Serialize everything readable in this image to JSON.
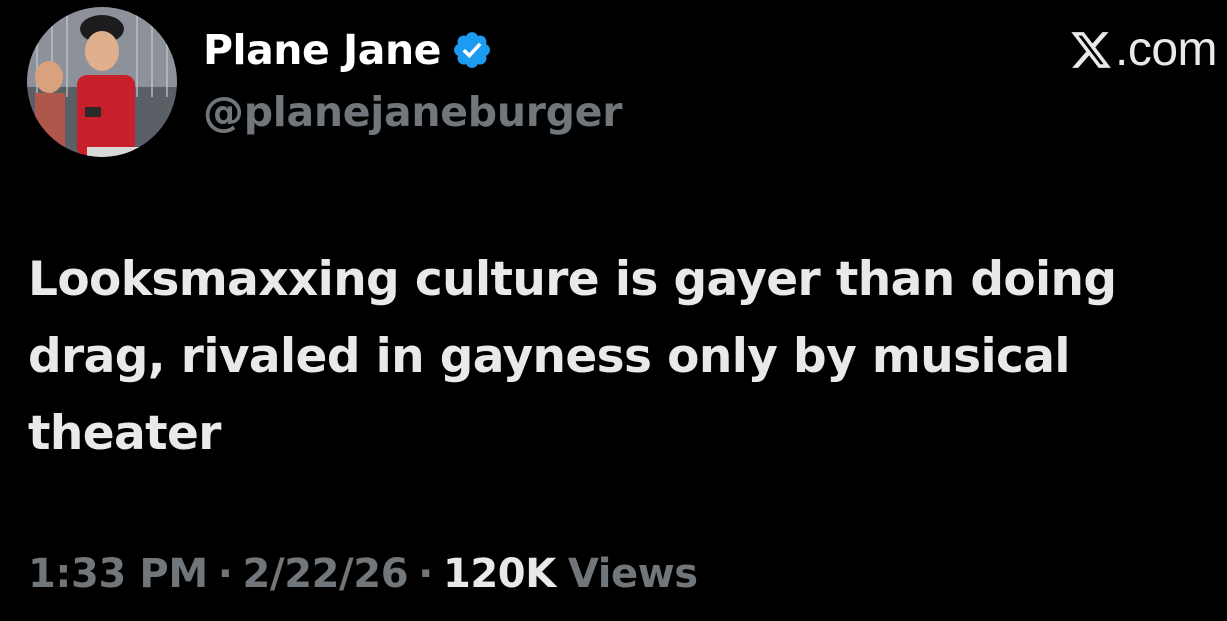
{
  "author": {
    "display_name": "Plane Jane",
    "handle": "@planejaneburger",
    "verified": true,
    "avatar_icon": "avatar-photo"
  },
  "source": {
    "logo_icon": "x-logo-icon",
    "suffix": ".com"
  },
  "tweet": {
    "text": "Looksmaxxing culture is gayer than doing drag, rivaled in gayness only by musical theater"
  },
  "meta": {
    "time": "1:33 PM",
    "separator": "·",
    "date": "2/22/26",
    "views_count": "120K",
    "views_label": "Views"
  },
  "colors": {
    "background": "#000000",
    "primary_text": "#e7e9ea",
    "secondary_text": "#71767b",
    "verified_blue": "#1d9bf0"
  }
}
